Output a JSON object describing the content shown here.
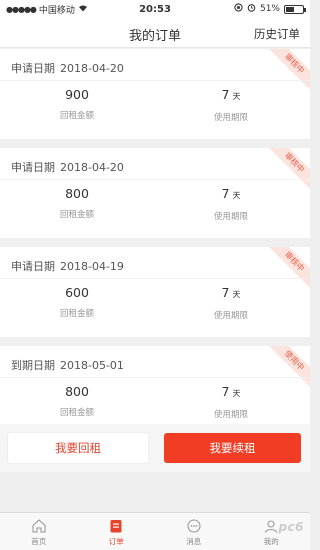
{
  "status_bar": {
    "carrier": "中国移动",
    "time": "20:53",
    "battery": "51%",
    "battery_level": 0.51
  },
  "nav": {
    "title": "我的订单",
    "history": "历史订单"
  },
  "orders": [
    {
      "date_label": "申请日期",
      "date": "2018-04-20",
      "amount": "900",
      "amount_label": "回租金额",
      "term": "7",
      "term_unit": "天",
      "term_label": "使用期限",
      "status": "审核中"
    },
    {
      "date_label": "申请日期",
      "date": "2018-04-20",
      "amount": "800",
      "amount_label": "回租金额",
      "term": "7",
      "term_unit": "天",
      "term_label": "使用期限",
      "status": "审核中"
    },
    {
      "date_label": "申请日期",
      "date": "2018-04-19",
      "amount": "600",
      "amount_label": "回租金额",
      "term": "7",
      "term_unit": "天",
      "term_label": "使用期限",
      "status": "审核中"
    },
    {
      "date_label": "到期日期",
      "date": "2018-05-01",
      "amount": "800",
      "amount_label": "回租金额",
      "term": "7",
      "term_unit": "天",
      "term_label": "使用期限",
      "status": "使用中"
    }
  ],
  "actions": {
    "return_label": "我要回租",
    "renew_label": "我要续租"
  },
  "tabs": [
    {
      "label": "首页",
      "icon": "home-icon"
    },
    {
      "label": "订单",
      "icon": "order-icon",
      "active": true
    },
    {
      "label": "消息",
      "icon": "message-icon"
    },
    {
      "label": "我的",
      "icon": "profile-icon"
    }
  ],
  "watermark": "pc6",
  "colors": {
    "accent": "#f23d25",
    "badge_bg": "#fbe3de",
    "badge_text": "#e9604b"
  }
}
